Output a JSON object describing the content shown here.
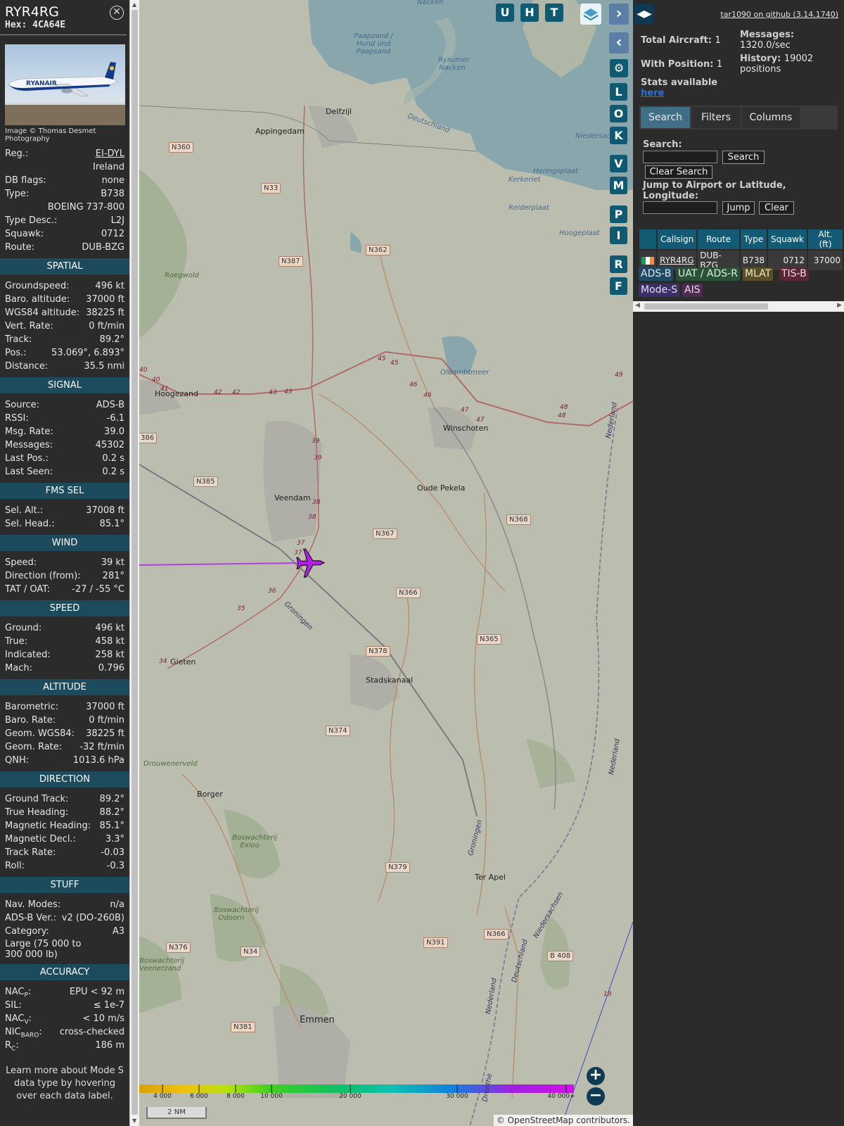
{
  "aircraft": {
    "callsign": "RYR4RG",
    "hex_label": "Hex:",
    "hex": "4CA64E",
    "photo_credit": "Image © Thomas Desmet Photography",
    "photo_livery_text": "RYANAIR",
    "details": [
      {
        "label": "Reg.:",
        "value": "EI-DYL"
      },
      {
        "label": "",
        "value": "Ireland"
      },
      {
        "label": "DB flags:",
        "value": "none"
      },
      {
        "label": "Type:",
        "value": "B738"
      },
      {
        "label": "",
        "value": "BOEING 737-800"
      },
      {
        "label": "Type Desc.:",
        "value": "L2J"
      },
      {
        "label": "Squawk:",
        "value": "0712"
      },
      {
        "label": "Route:",
        "value": "DUB-BZG"
      }
    ]
  },
  "sections": [
    {
      "title": "SPATIAL",
      "rows": [
        {
          "label": "Groundspeed:",
          "value": "496 kt"
        },
        {
          "label": "Baro. altitude:",
          "value": "37000 ft"
        },
        {
          "label": "WGS84 altitude:",
          "value": "38225 ft"
        },
        {
          "label": "Vert. Rate:",
          "value": "0 ft/min"
        },
        {
          "label": "Track:",
          "value": "89.2°"
        },
        {
          "label": "Pos.:",
          "value": "53.069°, 6.893°"
        },
        {
          "label": "Distance:",
          "value": "35.5 nmi"
        }
      ]
    },
    {
      "title": "SIGNAL",
      "rows": [
        {
          "label": "Source:",
          "value": "ADS-B"
        },
        {
          "label": "RSSI:",
          "value": "-6.1"
        },
        {
          "label": "Msg. Rate:",
          "value": "39.0"
        },
        {
          "label": "Messages:",
          "value": "45302"
        },
        {
          "label": "Last Pos.:",
          "value": "0.2 s"
        },
        {
          "label": "Last Seen:",
          "value": "0.2 s"
        }
      ]
    },
    {
      "title": "FMS SEL",
      "rows": [
        {
          "label": "Sel. Alt.:",
          "value": "37008 ft"
        },
        {
          "label": "Sel. Head.:",
          "value": "85.1°"
        }
      ]
    },
    {
      "title": "WIND",
      "rows": [
        {
          "label": "Speed:",
          "value": "39 kt"
        },
        {
          "label": "Direction (from):",
          "value": "281°"
        },
        {
          "label": "TAT / OAT:",
          "value": "-27 / -55 °C"
        }
      ]
    },
    {
      "title": "SPEED",
      "rows": [
        {
          "label": "Ground:",
          "value": "496 kt"
        },
        {
          "label": "True:",
          "value": "458 kt"
        },
        {
          "label": "Indicated:",
          "value": "258 kt"
        },
        {
          "label": "Mach:",
          "value": "0.796"
        }
      ]
    },
    {
      "title": "ALTITUDE",
      "rows": [
        {
          "label": "Barometric:",
          "value": "37000 ft"
        },
        {
          "label": "Baro. Rate:",
          "value": "0 ft/min"
        },
        {
          "label": "Geom. WGS84:",
          "value": "38225 ft"
        },
        {
          "label": "Geom. Rate:",
          "value": "-32 ft/min"
        },
        {
          "label": "QNH:",
          "value": "1013.6 hPa"
        }
      ]
    },
    {
      "title": "DIRECTION",
      "rows": [
        {
          "label": "Ground Track:",
          "value": "89.2°"
        },
        {
          "label": "True Heading:",
          "value": "88.2°"
        },
        {
          "label": "Magnetic Heading:",
          "value": "85.1°"
        },
        {
          "label": "Magnetic Decl.:",
          "value": "3.3°"
        },
        {
          "label": "Track Rate:",
          "value": "-0.03"
        },
        {
          "label": "Roll:",
          "value": "-0.3"
        }
      ]
    },
    {
      "title": "STUFF",
      "rows": [
        {
          "label": "Nav. Modes:",
          "value": "n/a"
        },
        {
          "label": "ADS-B Ver.:",
          "value": "v2 (DO-260B)"
        },
        {
          "label": "Category:",
          "value": "A3"
        }
      ],
      "note": "Large (75 000 to 300 000 lb)"
    },
    {
      "title": "ACCURACY",
      "rows": [
        {
          "label": "NAC",
          "sub": "P",
          "suffix": ":",
          "value": "EPU < 92 m"
        },
        {
          "label": "SIL:",
          "value": "≤ 1e-7"
        },
        {
          "label": "NAC",
          "sub": "V",
          "suffix": ":",
          "value": "< 10 m/s"
        },
        {
          "label": "NIC",
          "sub": "BARO",
          "suffix": ":",
          "value": "cross-checked"
        },
        {
          "label": "R",
          "sub": "C",
          "suffix": ":",
          "value": "186 m"
        }
      ]
    }
  ],
  "footnote": "Learn more about Mode S data type by hovering over each data label.",
  "map": {
    "toolbar_top": [
      "U",
      "H",
      "T"
    ],
    "toolbar_side": [
      "L",
      "O",
      "K",
      "V",
      "M",
      "P",
      "I",
      "R",
      "F"
    ],
    "places": [
      {
        "name": "Delfzijl"
      },
      {
        "name": "Appingedam"
      },
      {
        "name": "Hoogezand"
      },
      {
        "name": "Winschoten"
      },
      {
        "name": "Oude Pekela"
      },
      {
        "name": "Veendam"
      },
      {
        "name": "Stadskanaal"
      },
      {
        "name": "Gieten"
      },
      {
        "name": "Borger"
      },
      {
        "name": "Ter Apel"
      },
      {
        "name": "Emmen"
      }
    ],
    "water_labels": [
      "Nacken",
      "Paapzand / Hund und Paapsand",
      "Rysumer Nacken",
      "Deutschland",
      "Niedersachsen",
      "Heringsplaat",
      "Kerkeriet",
      "Reiderplaat",
      "Hoogeplaat",
      "Oldambtmeer"
    ],
    "green_labels": [
      "Roegwold",
      "Drouwenerveld",
      "Boswachterij Exloo",
      "Boswachterij Odoorn",
      "Boswachterij Veenerzand"
    ],
    "roads": [
      "N360",
      "N33",
      "N362",
      "N387",
      "N385",
      "N367",
      "N368",
      "N366",
      "N365",
      "N378",
      "N374",
      "N379",
      "N391",
      "N366",
      "B 408",
      "N376",
      "N34",
      "N381",
      "N34",
      "386"
    ],
    "motorway_km": [
      "40",
      "40",
      "41",
      "42",
      "42",
      "43",
      "43",
      "45",
      "45",
      "46",
      "46",
      "47",
      "47",
      "48",
      "48",
      "49",
      "39",
      "39",
      "38",
      "38",
      "37",
      "37",
      "36",
      "35",
      "34",
      "19"
    ],
    "border_labels": [
      "Groningen",
      "Groningen",
      "Nederland",
      "Nederland",
      "Niedersachsen",
      "Nederland",
      "Deutschland",
      "Drenthe"
    ],
    "altitude_legend": [
      "4 000",
      "6 000",
      "8 000",
      "10 000",
      "20 000",
      "30 000",
      "40 000+"
    ],
    "scale": "2 NM",
    "attribution": "© OpenStreetMap contributors.",
    "zoom_in": "+",
    "zoom_out": "−",
    "track_color": "#b040e0",
    "plane_color": "#b21fe6"
  },
  "right": {
    "toggle": "◀▶",
    "version_link": "tar1090 on github (3.14.1740)",
    "total_aircraft_label": "Total Aircraft:",
    "total_aircraft": "1",
    "with_position_label": "With Position:",
    "with_position": "1",
    "messages_label": "Messages:",
    "messages_rate": "1320.0/sec",
    "history_label": "History:",
    "history_value": "19002 positions",
    "stats_text": "Stats available",
    "stats_link": "here",
    "tabs": [
      "Search",
      "Filters",
      "Columns"
    ],
    "search_label": "Search:",
    "search_button": "Search",
    "clear_search_button": "Clear Search",
    "jump_label": "Jump to Airport or Latitude, Longitude:",
    "jump_button": "Jump",
    "clear_button": "Clear",
    "table_headers": [
      "",
      "Callsign",
      "Route",
      "Type",
      "Squawk",
      "Alt. (ft)"
    ],
    "table_rows": [
      {
        "callsign": "RYR4RG",
        "route": "DUB-BZG",
        "type": "B738",
        "squawk": "0712",
        "alt": "37000"
      }
    ],
    "sources": [
      {
        "label": "ADS-B",
        "bg": "#1f4a66",
        "fg": "#dfeaf2"
      },
      {
        "label": "UAT / ADS-R",
        "bg": "#2a5238",
        "fg": "#dff0e2"
      },
      {
        "label": "MLAT",
        "bg": "#59502a",
        "fg": "#f1e9c4"
      },
      {
        "label": "TIS-B",
        "bg": "#5a2737",
        "fg": "#f4d5de"
      },
      {
        "label": "Mode-S",
        "bg": "#3b2f66",
        "fg": "#e2dcf6"
      },
      {
        "label": "AIS",
        "bg": "#4e2b4e",
        "fg": "#f1dcf1"
      }
    ]
  }
}
